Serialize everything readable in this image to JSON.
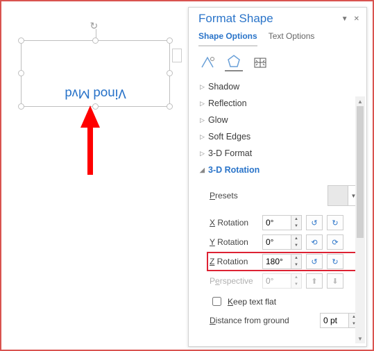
{
  "shape_text": "Vinod Mvd",
  "panel": {
    "title": "Format Shape",
    "tabs": {
      "shape": "Shape Options",
      "text": "Text Options"
    },
    "sections": {
      "shadow": "Shadow",
      "reflection": "Reflection",
      "glow": "Glow",
      "softedges": "Soft Edges",
      "format3d": "3-D Format",
      "rotation3d": "3-D Rotation"
    },
    "rotation": {
      "presets_label": "Presets",
      "x_label": "X Rotation",
      "y_label": "Y Rotation",
      "z_label": "Z Rotation",
      "perspective_label": "Perspective",
      "x_value": "0°",
      "y_value": "0°",
      "z_value": "180°",
      "perspective_value": "0°",
      "keep_text_flat": "Keep text flat",
      "distance_label": "Distance from ground",
      "distance_value": "0 pt"
    }
  }
}
